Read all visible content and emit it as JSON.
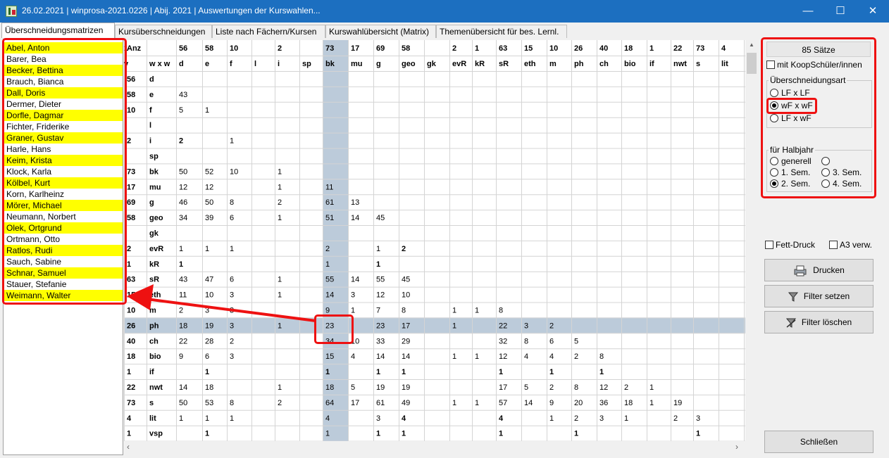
{
  "window": {
    "title": "26.02.2021 | winprosa-2021.0226 | Abij. 2021 | Auswertungen der Kurswahlen...",
    "minimize_glyph": "—",
    "maximize_glyph": "☐",
    "close_glyph": "✕"
  },
  "tabs": [
    {
      "label": "Überschneidungsmatrizen",
      "active": true
    },
    {
      "label": "Kursüberschneidungen"
    },
    {
      "label": "Liste nach Fächern/Kursen"
    },
    {
      "label": "Kurswahlübersicht (Matrix)"
    },
    {
      "label": "Themenübersicht für bes. Lernl."
    }
  ],
  "students": [
    {
      "name": "Abel, Anton",
      "hl": true
    },
    {
      "name": "Barer, Bea",
      "hl": false
    },
    {
      "name": "Becker, Bettina",
      "hl": true
    },
    {
      "name": "Brauch, Bianca",
      "hl": false
    },
    {
      "name": "Dall, Doris",
      "hl": true
    },
    {
      "name": "Dermer, Dieter",
      "hl": false
    },
    {
      "name": "Dorfle, Dagmar",
      "hl": true
    },
    {
      "name": "Fichter, Friderike",
      "hl": false
    },
    {
      "name": "Graner, Gustav",
      "hl": true
    },
    {
      "name": "Harle, Hans",
      "hl": false
    },
    {
      "name": "Keim, Krista",
      "hl": true
    },
    {
      "name": "Klock, Karla",
      "hl": false
    },
    {
      "name": "Kölbel, Kurt",
      "hl": true
    },
    {
      "name": "Korn, Karlheinz",
      "hl": false
    },
    {
      "name": "Mörer, Michael",
      "hl": true
    },
    {
      "name": "Neumann, Norbert",
      "hl": false
    },
    {
      "name": "Olek, Ortgrund",
      "hl": true
    },
    {
      "name": "Ortmann, Otto",
      "hl": false
    },
    {
      "name": "Ratlos, Rudi",
      "hl": true
    },
    {
      "name": "Sauch, Sabine",
      "hl": false
    },
    {
      "name": "Schnar, Samuel",
      "hl": true
    },
    {
      "name": "Stauer, Stefanie",
      "hl": false
    },
    {
      "name": "Weimann, Walter",
      "hl": true
    }
  ],
  "matrix": {
    "corner_top": "Anz",
    "corner_bottom": "w x w",
    "subjects": [
      "d",
      "e",
      "f",
      "l",
      "i",
      "sp",
      "bk",
      "mu",
      "g",
      "geo",
      "gk",
      "evR",
      "kR",
      "sR",
      "eth",
      "m",
      "ph",
      "ch",
      "bio",
      "if",
      "nwt",
      "s",
      "lit",
      "vsp"
    ],
    "counts": [
      "56",
      "58",
      "10",
      "",
      "2",
      "",
      "73",
      "17",
      "69",
      "58",
      "",
      "2",
      "1",
      "63",
      "15",
      "10",
      "26",
      "40",
      "18",
      "1",
      "22",
      "73",
      "4",
      "1"
    ],
    "rows": [
      [],
      [
        "43"
      ],
      [
        "5",
        "1"
      ],
      [],
      [
        "2",
        "",
        "1"
      ],
      [],
      [
        "50",
        "52",
        "10",
        "",
        "1"
      ],
      [
        "12",
        "12",
        "",
        "",
        "1",
        "",
        "11"
      ],
      [
        "46",
        "50",
        "8",
        "",
        "2",
        "",
        "61",
        "13"
      ],
      [
        "34",
        "39",
        "6",
        "",
        "1",
        "",
        "51",
        "14",
        "45"
      ],
      [],
      [
        "1",
        "1",
        "1",
        "",
        "",
        "",
        "2",
        "",
        "1",
        "2"
      ],
      [
        "1",
        "",
        "",
        "",
        "",
        "",
        "1",
        "",
        "1"
      ],
      [
        "43",
        "47",
        "6",
        "",
        "1",
        "",
        "55",
        "14",
        "55",
        "45"
      ],
      [
        "11",
        "10",
        "3",
        "",
        "1",
        "",
        "14",
        "3",
        "12",
        "10"
      ],
      [
        "2",
        "3",
        "3",
        "",
        "",
        "",
        "9",
        "1",
        "7",
        "8",
        "",
        "1",
        "1",
        "8"
      ],
      [
        "18",
        "19",
        "3",
        "",
        "1",
        "",
        "23",
        "",
        "23",
        "17",
        "",
        "1",
        "",
        "22",
        "3",
        "2"
      ],
      [
        "22",
        "28",
        "2",
        "",
        "",
        "",
        "34",
        "10",
        "33",
        "29",
        "",
        "",
        "",
        "32",
        "8",
        "6",
        "5"
      ],
      [
        "9",
        "6",
        "3",
        "",
        "",
        "",
        "15",
        "4",
        "14",
        "14",
        "",
        "1",
        "1",
        "12",
        "4",
        "4",
        "2",
        "8"
      ],
      [
        "",
        "1",
        "",
        "",
        "",
        "",
        "1",
        "",
        "1",
        "1",
        "",
        "",
        "",
        "1",
        "",
        "1",
        "",
        "1"
      ],
      [
        "14",
        "18",
        "",
        "",
        "1",
        "",
        "18",
        "5",
        "19",
        "19",
        "",
        "",
        "",
        "17",
        "5",
        "2",
        "8",
        "12",
        "2",
        "1"
      ],
      [
        "50",
        "53",
        "8",
        "",
        "2",
        "",
        "64",
        "17",
        "61",
        "49",
        "",
        "1",
        "1",
        "57",
        "14",
        "9",
        "20",
        "36",
        "18",
        "1",
        "19"
      ],
      [
        "1",
        "1",
        "1",
        "",
        "",
        "",
        "4",
        "",
        "3",
        "4",
        "",
        "",
        "",
        "4",
        "",
        "1",
        "2",
        "3",
        "1",
        "",
        "2",
        "3"
      ],
      [
        "",
        "1",
        "",
        "",
        "",
        "",
        "1",
        "",
        "1",
        "1",
        "",
        "",
        "",
        "1",
        "",
        "",
        "1",
        "",
        "",
        "",
        "",
        "1"
      ]
    ],
    "bold_cells": [
      "4-0",
      "11-9",
      "12-0",
      "12-8",
      "19-1",
      "19-6",
      "19-8",
      "19-9",
      "19-13",
      "19-15",
      "19-17",
      "22-9",
      "22-13",
      "23-1",
      "23-8",
      "23-9",
      "23-13",
      "23-16",
      "23-21"
    ],
    "highlight_col": 6,
    "highlight_row": 16,
    "highlight_colors": {
      "column": "#bccbda",
      "row": "#bccbda"
    },
    "extra_header_cols": [
      {
        "count": "1",
        "subject": "v"
      }
    ]
  },
  "right_panel": {
    "records": "85 Sätze",
    "koop_label": "mit KoopSchüler/innen",
    "group1_title": "Überschneidungsart",
    "radio_lf_lf": "LF x LF",
    "radio_wf_wf": "wF x wF",
    "radio_lf_wf": "LF x wF",
    "group2_title": "für Halbjahr",
    "radio_generell": "generell",
    "radio_sem1": "1. Sem.",
    "radio_sem2": "2. Sem.",
    "radio_sem3": "3. Sem.",
    "radio_sem4": "4. Sem.",
    "fett_label": "Fett-Druck",
    "a3_label": "A3 verw.",
    "btn_print": "Drucken",
    "btn_filter_set": "Filter setzen",
    "btn_filter_clear": "Filter löschen",
    "btn_close": "Schließen"
  },
  "colors": {
    "highlight_yellow": "#ffff00",
    "annotation_red": "#ee1111",
    "titlebar_blue": "#1c6fc0"
  },
  "icons": [
    "app-icon",
    "printer-icon",
    "filter-icon",
    "filter-clear-icon",
    "radio-checked-icon"
  ]
}
